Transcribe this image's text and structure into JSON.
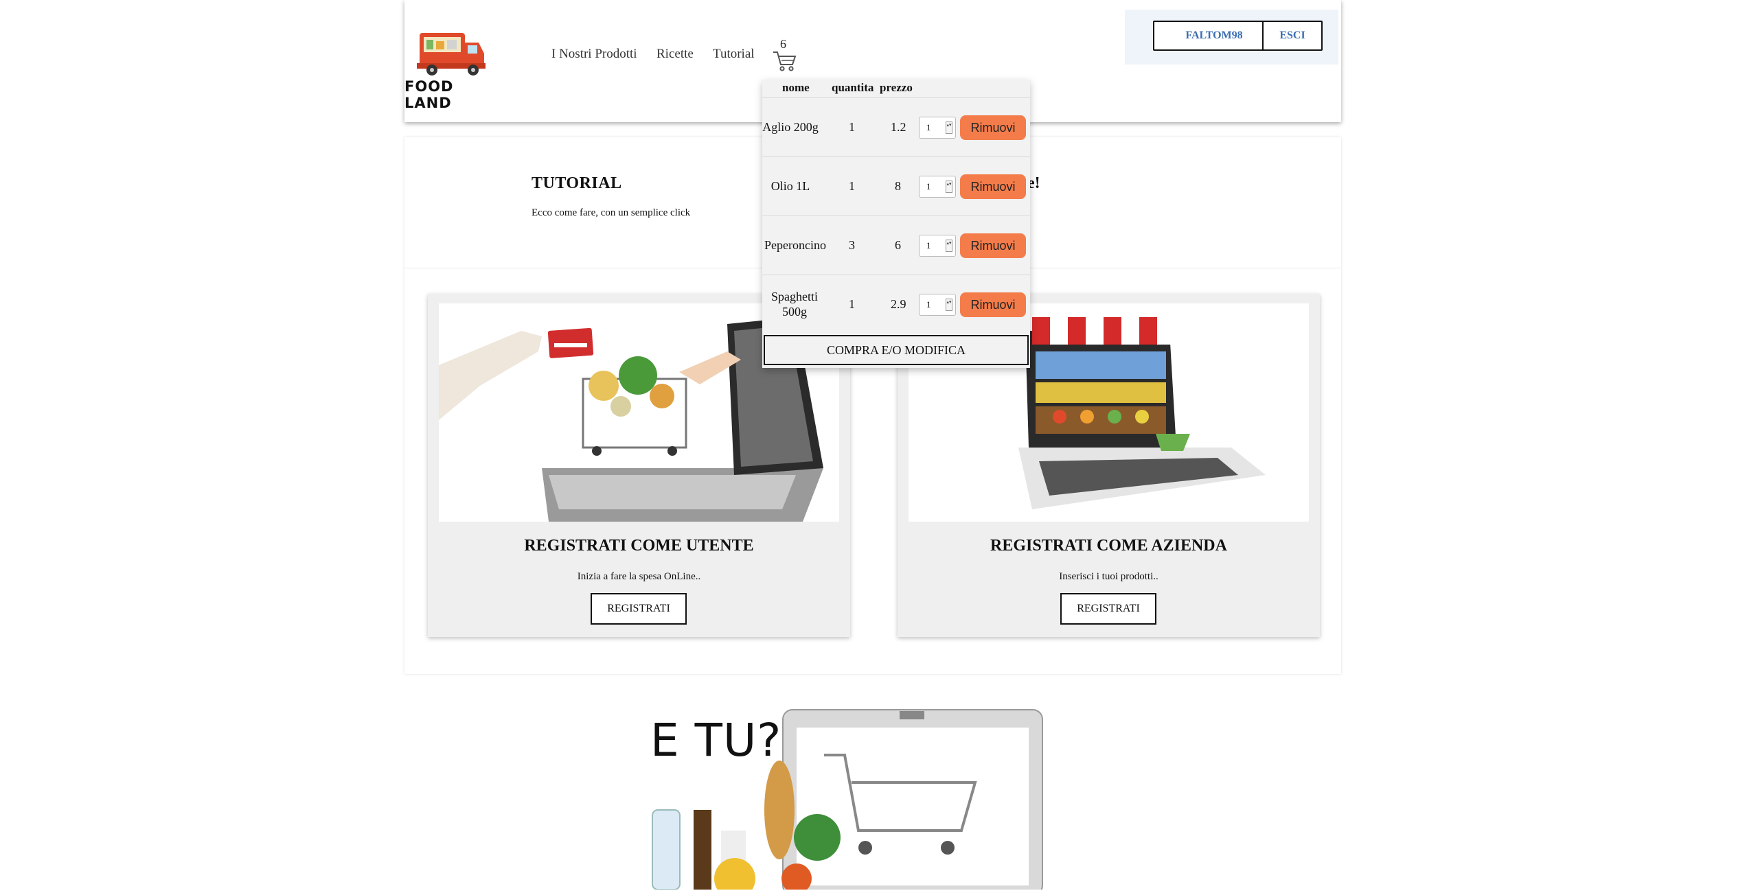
{
  "header": {
    "logo_text": "FOOD LAND",
    "nav": [
      "I Nostri Prodotti",
      "Ricette",
      "Tutorial"
    ],
    "cart_count": "6",
    "user_button": "FALTOM98",
    "logout_button": "ESCI"
  },
  "tutorial": {
    "title": "TUTORIAL",
    "subtitle": "Ecco come fare, con un semplice click",
    "right_text_visible": "e!"
  },
  "cards": [
    {
      "title": "REGISTRATI COME UTENTE",
      "description": "Inizia a fare la spesa OnLine..",
      "button": "REGISTRATI"
    },
    {
      "title": "REGISTRATI COME AZIENDA",
      "description": "Inserisci i tuoi prodotti..",
      "button": "REGISTRATI"
    }
  ],
  "promo": {
    "text": "E TU?"
  },
  "cart_dropdown": {
    "columns": [
      "nome",
      "quantita",
      "prezzo"
    ],
    "items": [
      {
        "nome": "Aglio 200g",
        "quantita": "1",
        "prezzo": "1.2",
        "input": "1",
        "remove": "Rimuovi"
      },
      {
        "nome": "Olio 1L",
        "quantita": "1",
        "prezzo": "8",
        "input": "1",
        "remove": "Rimuovi"
      },
      {
        "nome": "Peperoncino",
        "quantita": "3",
        "prezzo": "6",
        "input": "1",
        "remove": "Rimuovi"
      },
      {
        "nome": "Spaghetti 500g",
        "quantita": "1",
        "prezzo": "2.9",
        "input": "1",
        "remove": "Rimuovi"
      }
    ],
    "buy_button": "COMPRA E/O MODIFICA"
  },
  "colors": {
    "accent": "#f47c4a",
    "user_link": "#3a6db3",
    "user_box_bg": "#eef4fa"
  }
}
